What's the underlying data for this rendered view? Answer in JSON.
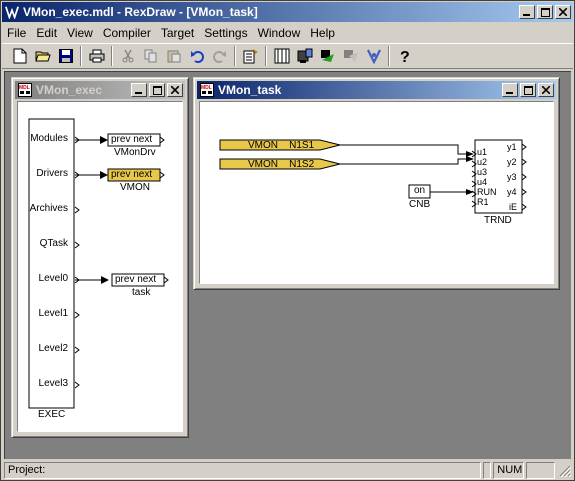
{
  "app": {
    "title": "VMon_exec.mdl - RexDraw - [VMon_task]"
  },
  "menu": [
    {
      "label": "File",
      "name": "menu-file"
    },
    {
      "label": "Edit",
      "name": "menu-edit"
    },
    {
      "label": "View",
      "name": "menu-view"
    },
    {
      "label": "Compiler",
      "name": "menu-compiler"
    },
    {
      "label": "Target",
      "name": "menu-target"
    },
    {
      "label": "Settings",
      "name": "menu-settings"
    },
    {
      "label": "Window",
      "name": "menu-window"
    },
    {
      "label": "Help",
      "name": "menu-help"
    }
  ],
  "toolbar": {
    "icons": [
      "new-file-icon",
      "open-folder-icon",
      "save-icon",
      "print-icon",
      "cut-icon",
      "copy-icon",
      "paste-icon",
      "undo-icon",
      "redo-icon",
      "compile-icon",
      "diagnostics-icon",
      "download-icon",
      "connect-icon",
      "watch-icon",
      "target-icon",
      "help-icon"
    ]
  },
  "exec_window": {
    "title": "VMon_exec",
    "block_name": "EXEC",
    "ports": [
      "Modules",
      "Drivers",
      "Archives",
      "QTask",
      "Level0",
      "Level1",
      "Level2",
      "Level3"
    ],
    "subblocks": [
      {
        "text": "prev  next",
        "label": "VMonDrv",
        "highlight": false
      },
      {
        "text": "prev  next",
        "label": "VMON",
        "highlight": true
      },
      {
        "text": "prev  next",
        "label": "task",
        "highlight": false
      }
    ]
  },
  "task_window": {
    "title": "VMon_task",
    "inputs": [
      "VMON__N1S1",
      "VMON__N1S2"
    ],
    "const_block": {
      "value": "on",
      "label": "CNB"
    },
    "trnd": {
      "label": "TRND",
      "inputs": [
        "u1",
        "u2",
        "u3",
        "u4",
        "RUN",
        "R1"
      ],
      "outputs": [
        "y1",
        "y2",
        "y3",
        "y4",
        "iE"
      ]
    }
  },
  "statusbar": {
    "project_label": "Project:",
    "num": "NUM"
  },
  "colors": {
    "active_title_start": "#0a246a",
    "active_title_end": "#a6caf0",
    "inactive_title": "#808080",
    "goto_block_fill": "#e8c84a",
    "mdi_background": "#808080"
  }
}
